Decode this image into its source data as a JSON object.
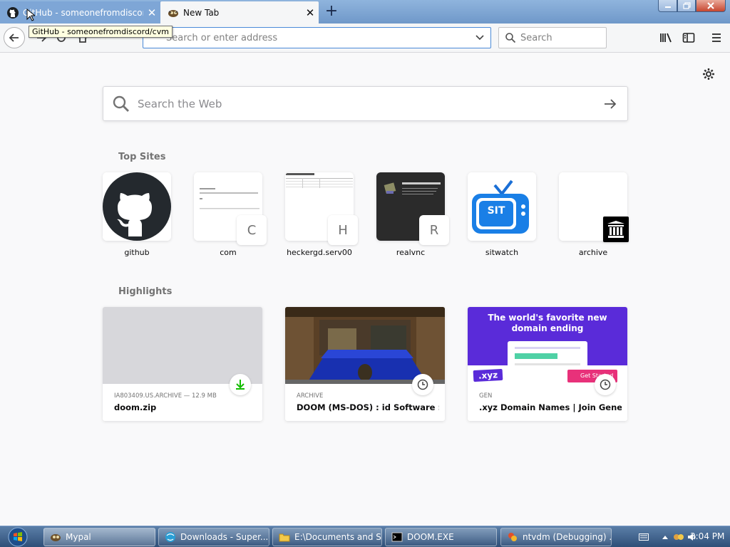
{
  "tabs": [
    {
      "title": "GitHub - someonefromdiscord",
      "close": "✕"
    },
    {
      "title": "New Tab",
      "close": "✕"
    }
  ],
  "new_tab": "+",
  "tooltip": "GitHub - someonefromdiscord/cvm",
  "urlbar": {
    "placeholder": "Search or enter address"
  },
  "searchbar": {
    "placeholder": "Search"
  },
  "websearch": {
    "placeholder": "Search the Web"
  },
  "top_sites": {
    "title": "Top Sites",
    "items": [
      {
        "label": "github",
        "letter": ""
      },
      {
        "label": "com",
        "letter": "C"
      },
      {
        "label": "heckergd.serv00",
        "letter": "H"
      },
      {
        "label": "realvnc",
        "letter": "R"
      },
      {
        "label": "sitwatch",
        "letter": ""
      },
      {
        "label": "archive",
        "letter": ""
      }
    ]
  },
  "highlights": {
    "title": "Highlights",
    "cards": [
      {
        "context": "IA803409.US.ARCHIVE — 12.9 MB",
        "title": "doom.zip",
        "badge": "download-icon"
      },
      {
        "context": "ARCHIVE",
        "title": "DOOM (MS-DOS) : id Software : ...",
        "badge": "clock-icon"
      },
      {
        "context": "GEN",
        "title": ".xyz Domain Names | Join Gener...",
        "badge": "clock-icon"
      }
    ]
  },
  "xyz_ad": {
    "headline1": "The world's favorite new",
    "headline2": "domain ending",
    "tag": ".xyz",
    "button": "Get Started"
  },
  "taskbar": {
    "items": [
      "Mypal",
      "Downloads - Super...",
      "E:\\Documents and S...",
      "DOOM.EXE",
      "ntvdm (Debugging) ..."
    ],
    "clock": "3:04 PM"
  },
  "colors": {
    "accent": "#0a84ff",
    "highlight_img_1": "#d7d7db",
    "xyz_purple": "#5a2bd9",
    "download_green": "#12bc00"
  }
}
